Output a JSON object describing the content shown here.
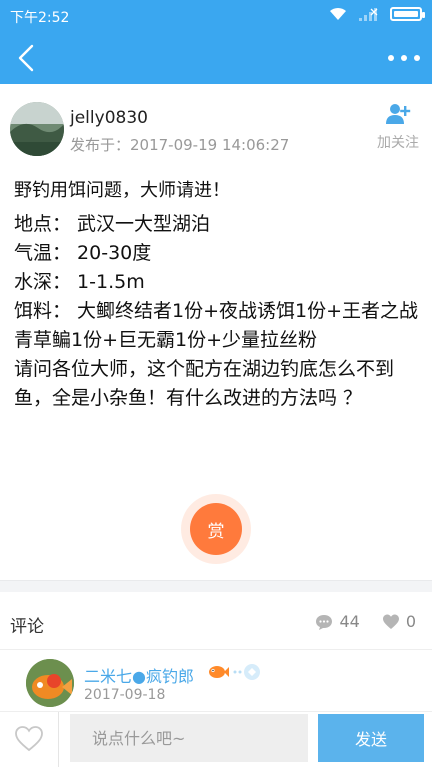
{
  "status_bar": {
    "time": "下午2:52"
  },
  "nav": {
    "back_icon": "chevron-left-icon",
    "more_icon": "more-dots-icon"
  },
  "author": {
    "name": "jelly0830",
    "post_time": "发布于：2017-09-19 14:06:27",
    "follow_label": "加关注"
  },
  "post": {
    "title": "野钓用饵问题，大师请进！",
    "lines": [
      "地点： 武汉一大型湖泊",
      "气温： 20-30度",
      "水深： 1-1.5m",
      "饵料： 大鲫终结者1份+夜战诱饵1份+王者之战青草鳊1份+巨无霸1份+少量拉丝粉",
      "请问各位大师，这个配方在湖边钓底怎么不到鱼，全是小杂鱼！有什么改进的方法吗 ？"
    ]
  },
  "tip": {
    "label": "赏"
  },
  "comments_section": {
    "title": "评论",
    "comment_count": "44",
    "like_count": "0"
  },
  "comment": {
    "author": "二米七●疯钓郎",
    "date": "2017-09-18"
  },
  "input_bar": {
    "placeholder": "说点什么吧~",
    "send_label": "发送"
  },
  "colors": {
    "primary": "#3aa7f0",
    "tip": "#ff7a3c",
    "link": "#4aa8e8",
    "send": "#5bb3ec"
  }
}
